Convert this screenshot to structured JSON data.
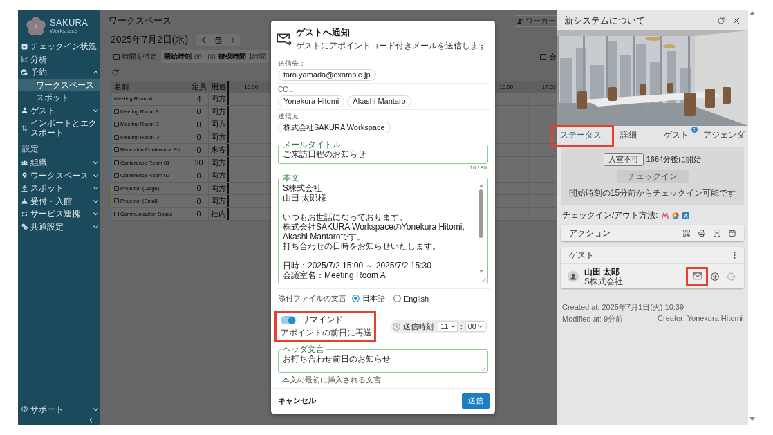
{
  "sidebar": {
    "brand": {
      "name": "SAKURA",
      "tagline": "Workspace"
    },
    "nav": [
      {
        "kind": "link",
        "label": "チェックイン状況",
        "selected": false
      },
      {
        "kind": "link",
        "label": "分析",
        "selected": false
      },
      {
        "kind": "group",
        "label": "予約",
        "selected": false,
        "expanded": true,
        "children": [
          {
            "label": "ワークスペース",
            "selected": true
          },
          {
            "label": "スポット",
            "selected": false
          }
        ]
      },
      {
        "kind": "group",
        "label": "ゲスト",
        "selected": false,
        "expanded": false
      },
      {
        "kind": "link",
        "label": "インポートとエクスポート",
        "selected": false
      }
    ],
    "settings_heading": "設定",
    "settings": [
      {
        "kind": "group",
        "label": "組織",
        "selected": false,
        "expanded": false
      },
      {
        "kind": "group",
        "label": "ワークスペース",
        "selected": false,
        "expanded": false
      },
      {
        "kind": "group",
        "label": "スポット",
        "selected": false,
        "expanded": false
      },
      {
        "kind": "group",
        "label": "受付・入館",
        "selected": false,
        "expanded": false
      },
      {
        "kind": "group",
        "label": "サービス連携",
        "selected": false,
        "expanded": false
      },
      {
        "kind": "group",
        "label": "共通設定",
        "selected": false,
        "expanded": false
      }
    ],
    "support": {
      "kind": "group",
      "label": "サポート",
      "selected": false,
      "expanded": false
    }
  },
  "main": {
    "title": "ワークスペース",
    "search": {
      "placeholder": "ワーカー"
    },
    "date": "2025年7月2日(水)",
    "filters": {
      "specify_time": {
        "label": "時間を特定",
        "checked": false
      },
      "start_time": {
        "label": "開始時刻",
        "value": "09 : 00",
        "disabled": true
      },
      "duration": {
        "label": "確保時間",
        "value": "1時間",
        "disabled": true
      },
      "extra": {
        "label": "会",
        "checked": false
      }
    },
    "table": {
      "columns": [
        "名前",
        "定員",
        "用途"
      ],
      "time_columns": [
        "10:00",
        "16:00",
        "17:00"
      ],
      "rows": [
        {
          "kind": "current",
          "name": "Meeting Room A",
          "capacity": "4",
          "usage": "両方",
          "color": "#33749a"
        },
        {
          "kind": "selectable",
          "checked": false,
          "name": "Meeting Room B",
          "capacity": "0",
          "usage": "両方",
          "color": "#33749a"
        },
        {
          "kind": "selectable",
          "checked": false,
          "name": "Meeting Room C",
          "capacity": "0",
          "usage": "両方",
          "color": "#33749a"
        },
        {
          "kind": "selectable",
          "checked": false,
          "name": "Meeting Room D",
          "capacity": "0",
          "usage": "両方",
          "color": "#33749a"
        },
        {
          "kind": "selectable",
          "checked": false,
          "name": "Reception Conference Ro…",
          "capacity": "0",
          "usage": "来客",
          "color": "#33749a"
        },
        {
          "kind": "selectable",
          "checked": false,
          "name": "Conference Room 01",
          "capacity": "20",
          "usage": "両方",
          "color": "#33749a"
        },
        {
          "kind": "selectable",
          "checked": false,
          "name": "Conference Room 02",
          "capacity": "0",
          "usage": "両方",
          "color": "#33749a"
        },
        {
          "kind": "selectable",
          "checked": false,
          "name": "Projector (Large)",
          "capacity": "0",
          "usage": "両方",
          "color": "#6f823c"
        },
        {
          "kind": "selectable",
          "checked": false,
          "name": "Projector (Small)",
          "capacity": "0",
          "usage": "両方",
          "color": "#6f823c"
        },
        {
          "kind": "selectable",
          "checked": false,
          "name": "Communication Space",
          "capacity": "0",
          "usage": "社内",
          "color": "#33749a"
        }
      ]
    }
  },
  "modal": {
    "title": "ゲストへ通知",
    "subtitle": "ゲストにアポイントコード付きメールを送信します",
    "recipients": [
      {
        "label": "送信先：",
        "chips": [
          "taro.yamada@example.jp"
        ]
      },
      {
        "label": "CC：",
        "chips": [
          "Yonekura Hitomi",
          "Akashi Mantaro"
        ]
      },
      {
        "label": "送信元：",
        "chips": [
          "株式会社SAKURA Workspace"
        ]
      }
    ],
    "mail_title": {
      "label": "メールタイトル",
      "value": "ご来訪日程のお知らせ",
      "counter": "10 / 80"
    },
    "body": {
      "label": "本文",
      "paragraphs": [
        [
          "S株式会社",
          "山田 太郎様"
        ],
        [
          "いつもお世話になっております。",
          "株式会社SAKURA WorkspaceのYonekura Hitomi, Akashi Mantaroです。",
          "打ち合わせの日時をお知らせいたします。"
        ],
        [
          "日時：2025/7/2 15:00 ～ 2025/7/2 15:30",
          "会議室名：Meeting Room A"
        ]
      ]
    },
    "attachment_language": {
      "label": "添付ファイルの文言",
      "options": [
        {
          "label": "日本語",
          "selected": true
        },
        {
          "label": "English",
          "selected": false
        }
      ]
    },
    "reminder": {
      "label": "リマインド",
      "caption": "アポイントの前日に再送",
      "on": true,
      "highlighted": true,
      "send_time": {
        "label": "送信時刻",
        "hour": "11",
        "separator": ":",
        "minute": "00"
      }
    },
    "header_text": {
      "label": "ヘッダ文言",
      "value": "お打ち合わせ前日のお知らせ",
      "helper": "本文の最初に挿入される文言"
    },
    "cancel_button": "キャンセル",
    "send_button": "送信"
  },
  "panel": {
    "title": "新システムについて",
    "tabs": [
      {
        "label": "ステータス",
        "selected": true,
        "highlighted": true
      },
      {
        "label": "詳細",
        "selected": false,
        "highlighted": false
      },
      {
        "label": "ゲスト",
        "selected": false,
        "highlighted": false,
        "badge": "1"
      },
      {
        "label": "アジェンダ",
        "selected": false,
        "highlighted": false
      }
    ],
    "status": {
      "entry_chip": "入室不可",
      "countdown": "1664分後に開始",
      "checkin_button": {
        "label": "チェックイン",
        "disabled": true
      },
      "note": "開始時刻の15分前からチェックイン可能です"
    },
    "checkin_methods_label": "チェックイン/アウト方法:",
    "actions_title": "アクション",
    "guests": {
      "title": "ゲスト",
      "items": [
        {
          "name": "山田 太郎",
          "company": "S株式会社",
          "actions": [
            {
              "kind": "notify",
              "disabled": false,
              "highlighted": true
            },
            {
              "kind": "check_in",
              "disabled": false,
              "highlighted": false
            },
            {
              "kind": "check_out",
              "disabled": true,
              "highlighted": false
            }
          ]
        }
      ]
    },
    "meta": [
      "Created at: 2025年7月1日(火) 10:39",
      "Modified at: 9分前",
      "Creator: Yonekura Hitomi"
    ]
  }
}
